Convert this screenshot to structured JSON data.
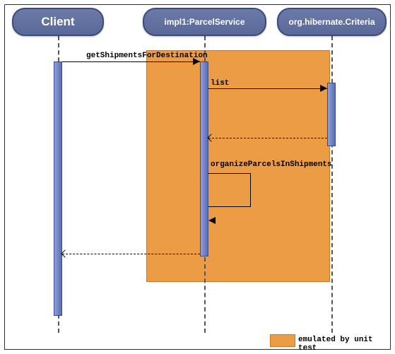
{
  "participants": {
    "client": "Client",
    "parcel": "impl1:ParcelService",
    "criteria": "org.hibernate.Criteria"
  },
  "messages": {
    "m1": "getShipmentsForDestination",
    "m2": "list",
    "m3": "organizeParcelsInShipments"
  },
  "legend": {
    "text": "emulated by unit test"
  }
}
